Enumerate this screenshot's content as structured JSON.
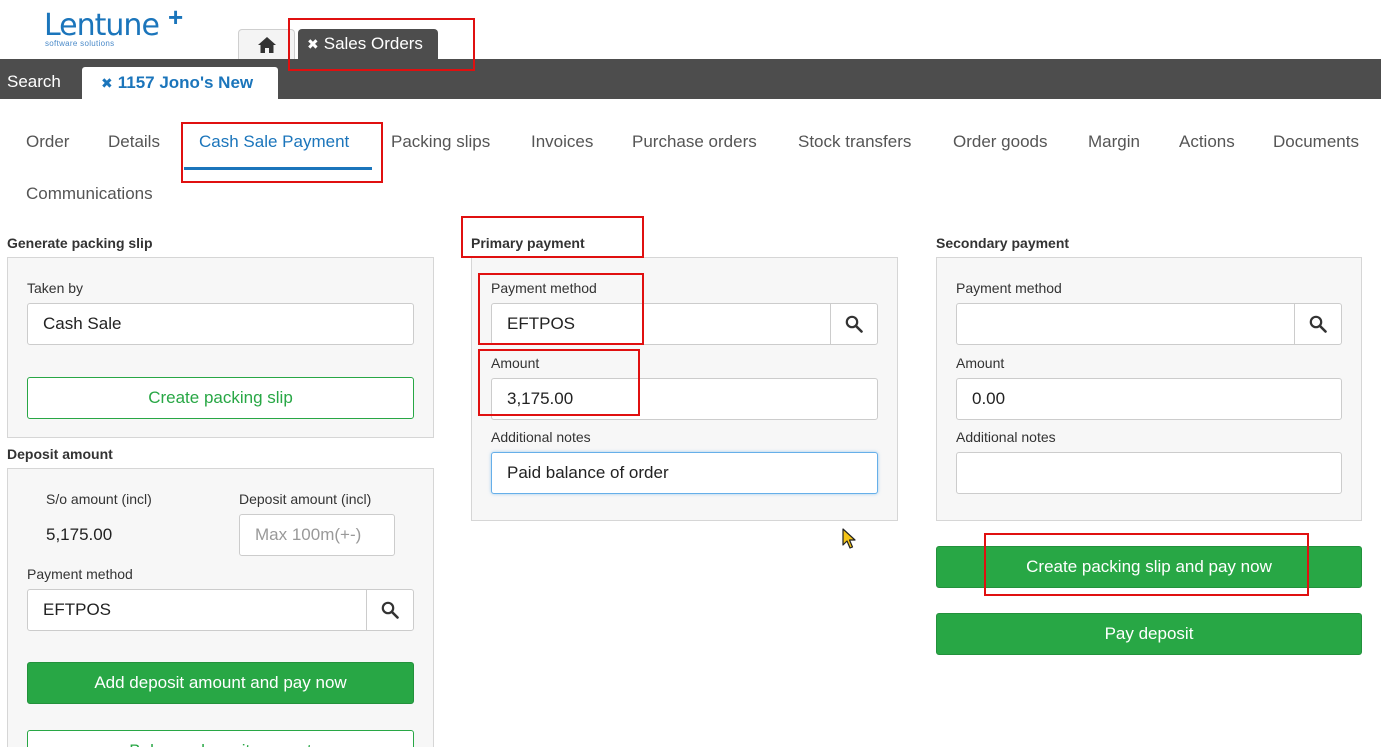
{
  "brand": {
    "name": "Lentune",
    "tagline": "software solutions"
  },
  "top_tabs": {
    "orders_label": "Sales Orders",
    "close_icon": "close-icon",
    "home_icon": "home-icon"
  },
  "second_bar": {
    "search_label": "Search",
    "record_label": "1157 Jono's New"
  },
  "nav_tabs": [
    "Order",
    "Details",
    "Cash Sale Payment",
    "Packing slips",
    "Invoices",
    "Purchase orders",
    "Stock transfers",
    "Order goods",
    "Margin",
    "Actions",
    "Documents",
    "Communications"
  ],
  "active_tab": "Cash Sale Payment",
  "packing_slip": {
    "title": "Generate packing slip",
    "taken_by_label": "Taken by",
    "taken_by_value": "Cash Sale",
    "create_button": "Create packing slip"
  },
  "deposit": {
    "title": "Deposit amount",
    "so_amount_label": "S/o amount (incl)",
    "so_amount_value": "5,175.00",
    "deposit_amount_label": "Deposit amount (incl)",
    "deposit_amount_placeholder": "Max 100m(+-)",
    "payment_method_label": "Payment method",
    "payment_method_value": "EFTPOS",
    "add_button": "Add deposit amount and pay now",
    "next_button_partial": "Balance deposit amount"
  },
  "primary_payment": {
    "title": "Primary payment",
    "payment_method_label": "Payment method",
    "payment_method_value": "EFTPOS",
    "amount_label": "Amount",
    "amount_value": "3,175.00",
    "notes_label": "Additional notes",
    "notes_value": "Paid balance of order"
  },
  "secondary_payment": {
    "title": "Secondary payment",
    "payment_method_label": "Payment method",
    "payment_method_value": "",
    "amount_label": "Amount",
    "amount_value": "0.00",
    "notes_label": "Additional notes",
    "notes_value": "",
    "create_pay_button": "Create packing slip and pay now",
    "pay_deposit_button": "Pay deposit"
  },
  "colors": {
    "brand_blue": "#1b75bb",
    "dark_bar": "#4d4d4d",
    "success_green": "#28a745",
    "annotation_red": "#e01010"
  }
}
